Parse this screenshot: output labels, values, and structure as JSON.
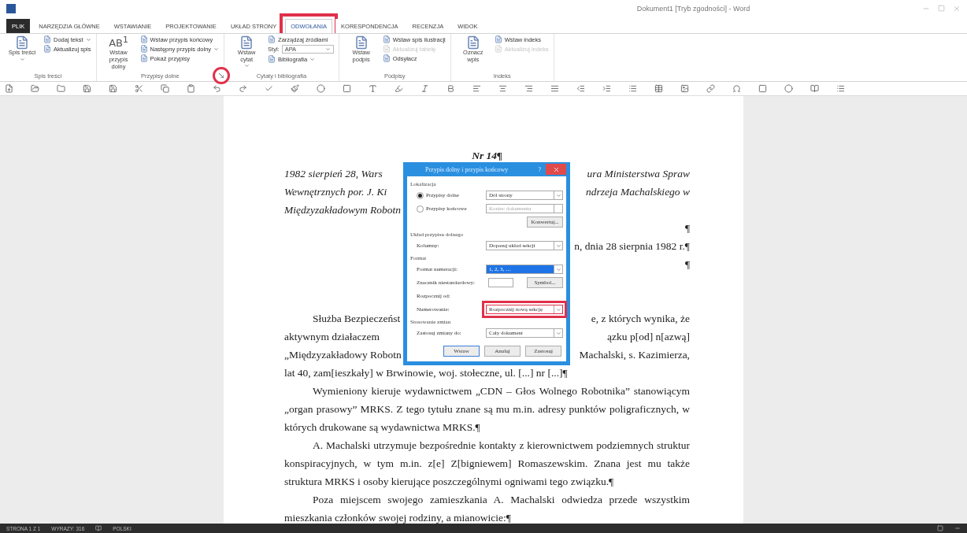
{
  "window": {
    "title": "Dokument1 [Tryb zgodności] - Word"
  },
  "tabs": [
    {
      "label": "PLIK",
      "kind": "file",
      "selected": false,
      "annotated": false
    },
    {
      "label": "NARZĘDZIA GŁÓWNE",
      "kind": "tab",
      "selected": false,
      "annotated": false
    },
    {
      "label": "WSTAWIANIE",
      "kind": "tab",
      "selected": false,
      "annotated": false
    },
    {
      "label": "PROJEKTOWANIE",
      "kind": "tab",
      "selected": false,
      "annotated": false
    },
    {
      "label": "UKŁAD STRONY",
      "kind": "tab",
      "selected": false,
      "annotated": false
    },
    {
      "label": "ODWOŁANIA",
      "kind": "tab",
      "selected": true,
      "annotated": true
    },
    {
      "label": "KORESPONDENCJA",
      "kind": "tab",
      "selected": false,
      "annotated": false
    },
    {
      "label": "RECENZJA",
      "kind": "tab",
      "selected": false,
      "annotated": false
    },
    {
      "label": "WIDOK",
      "kind": "tab",
      "selected": false,
      "annotated": false
    }
  ],
  "ribbon": {
    "groups": [
      {
        "label": "Spis treści",
        "large": [
          {
            "label": "Spis treści",
            "menu": true
          }
        ],
        "small": [
          {
            "kind": "button",
            "label": "Dodaj tekst",
            "menu": true,
            "disabled": false
          },
          {
            "kind": "button",
            "label": "Aktualizuj spis",
            "menu": false,
            "disabled": false
          }
        ]
      },
      {
        "label": "Przypisy dolne",
        "launcher": {
          "annotated": true
        },
        "large": [
          {
            "label": "Wstaw przypis dolny",
            "glyph": "AB$^{1}$",
            "menu": false
          }
        ],
        "small": [
          {
            "kind": "button",
            "label": "Wstaw przypis końcowy",
            "menu": false,
            "disabled": false
          },
          {
            "kind": "button",
            "label": "Następny przypis dolny",
            "menu": true,
            "disabled": false
          },
          {
            "kind": "button",
            "label": "Pokaż przypisy",
            "menu": false,
            "disabled": false
          }
        ]
      },
      {
        "label": "Cytaty i bibliografia",
        "large": [
          {
            "label": "Wstaw cytat",
            "menu": true
          }
        ],
        "small": [
          {
            "kind": "button",
            "label": "Zarządzaj źródłami",
            "menu": false,
            "disabled": false
          },
          {
            "kind": "combo",
            "label": "Styl:",
            "value": "APA"
          },
          {
            "kind": "button",
            "label": "Bibliografia",
            "menu": true,
            "disabled": false
          }
        ]
      },
      {
        "label": "Podpisy",
        "large": [
          {
            "label": "Wstaw podpis",
            "menu": false
          }
        ],
        "small": [
          {
            "kind": "button",
            "label": "Wstaw spis ilustracji",
            "menu": false,
            "disabled": false
          },
          {
            "kind": "button",
            "label": "Aktualizuj tabelę",
            "menu": false,
            "disabled": true
          },
          {
            "kind": "button",
            "label": "Odsyłacz",
            "menu": false,
            "disabled": false
          }
        ]
      },
      {
        "label": "Indeks",
        "large": [
          {
            "label": "Oznacz wpis",
            "menu": false
          }
        ],
        "small": [
          {
            "kind": "button",
            "label": "Wstaw indeks",
            "menu": false,
            "disabled": false
          },
          {
            "kind": "button",
            "label": "Aktualizuj indeks",
            "menu": false,
            "disabled": true
          }
        ]
      }
    ]
  },
  "document": {
    "heading": "Nr 14¶",
    "lines": [
      {
        "kind": "text",
        "left": "1982 sierpień 28, Wars",
        "right": "ura Ministerstwa Spraw",
        "italic": true,
        "indent": false
      },
      {
        "kind": "text",
        "left": "Wewnętrznych por. J. Ki",
        "right": "ndrzeja Machalskiego w",
        "italic": true,
        "indent": false
      },
      {
        "kind": "text",
        "left": "Międzyzakładowym Robotn",
        "italic": true,
        "indent": false
      },
      {
        "kind": "text",
        "right": "¶",
        "italic": false
      },
      {
        "kind": "text",
        "right": "n, dnia 28 sierpnia 1982 r.¶",
        "italic": false
      },
      {
        "kind": "text",
        "right": "¶",
        "italic": false
      },
      {
        "kind": "blank"
      },
      {
        "kind": "blank"
      },
      {
        "kind": "text",
        "left": "Służba Bezpieczeńst",
        "right": "e, z których wynika, że",
        "italic": false,
        "indent": true
      },
      {
        "kind": "text",
        "left": "aktywnym działaczem",
        "right": "ązku p[od] n[azwą]",
        "italic": false,
        "indent": false
      },
      {
        "kind": "text",
        "left": "„Międzyzakładowy Robotn",
        "right": "Machalski, s. Kazimierza,",
        "italic": false,
        "indent": false
      }
    ],
    "paragraphs": [
      {
        "text": "lat 40, zam[ieszkały] w Brwinowie, woj. stołeczne, ul. [...] nr [...]¶",
        "indent": false
      },
      {
        "text": "Wymieniony kieruje wydawnictwem „CDN – Głos Wolnego Robotnika” stanowiącym „organ prasowy” MRKS. Z tego tytułu znane są mu m.in. adresy punktów poligraficznych, w których drukowane są wydawnictwa MRKS.¶",
        "indent": true
      },
      {
        "text": "A. Machalski utrzymuje bezpośrednie kontakty z kierownictwem podziemnych struktur konspiracyjnych, w tym m.in. z[e] Z[bigniewem] Romaszewskim. Znana jest mu także struktura MRKS i osoby kierujące poszczególnymi ogniwami tego związku.¶",
        "indent": true
      },
      {
        "text": "Poza miejscem swojego zamieszkania A. Machalski odwiedza przede wszystkim mieszkania członków swojej rodziny, a mianowicie:¶",
        "indent": true
      }
    ]
  },
  "dialog": {
    "title": "Przypis dolny i przypis końcowy",
    "help": "?",
    "sections": [
      {
        "heading": "Lokalizacja",
        "rows": [
          {
            "kind": "radio",
            "label": "Przypisy dolne",
            "selected": true,
            "value": "Dół strony",
            "disabled": false
          },
          {
            "kind": "radio",
            "label": "Przypisy końcowe",
            "selected": false,
            "value": "Koniec dokumentu",
            "disabled": true
          },
          {
            "kind": "action",
            "label": "Konwertuj..."
          }
        ]
      },
      {
        "heading": "Układ przypisu dolnego",
        "rows": [
          {
            "kind": "select",
            "label": "Kolumny:",
            "value": "Dopasuj układ sekcji",
            "focused": false,
            "annotated": false
          }
        ]
      },
      {
        "heading": "Format",
        "rows": [
          {
            "kind": "select",
            "label": "Format numeracji:",
            "value": "1, 2, 3, …",
            "focused": true,
            "annotated": false
          },
          {
            "kind": "custom",
            "label": "Znacznik niestandardowy:",
            "button": "Symbol..."
          },
          {
            "kind": "label",
            "label": "Rozpocznij od:"
          },
          {
            "kind": "select",
            "label": "Numerowanie:",
            "value": "Rozpocznij nową sekcję",
            "focused": false,
            "annotated": true
          }
        ]
      },
      {
        "heading": "Stosowanie zmian",
        "rows": [
          {
            "kind": "select",
            "label": "Zastosuj zmiany do:",
            "value": "Cały dokument",
            "focused": false,
            "annotated": false
          }
        ]
      }
    ],
    "buttons": [
      {
        "label": "Wstaw",
        "default": true
      },
      {
        "label": "Anuluj",
        "default": false
      },
      {
        "label": "Zastosuj",
        "default": false
      }
    ]
  },
  "status_bar": {
    "page": "STRONA 1 Z 1",
    "words": "WYRAZY: 316",
    "language": "POLSKI"
  }
}
